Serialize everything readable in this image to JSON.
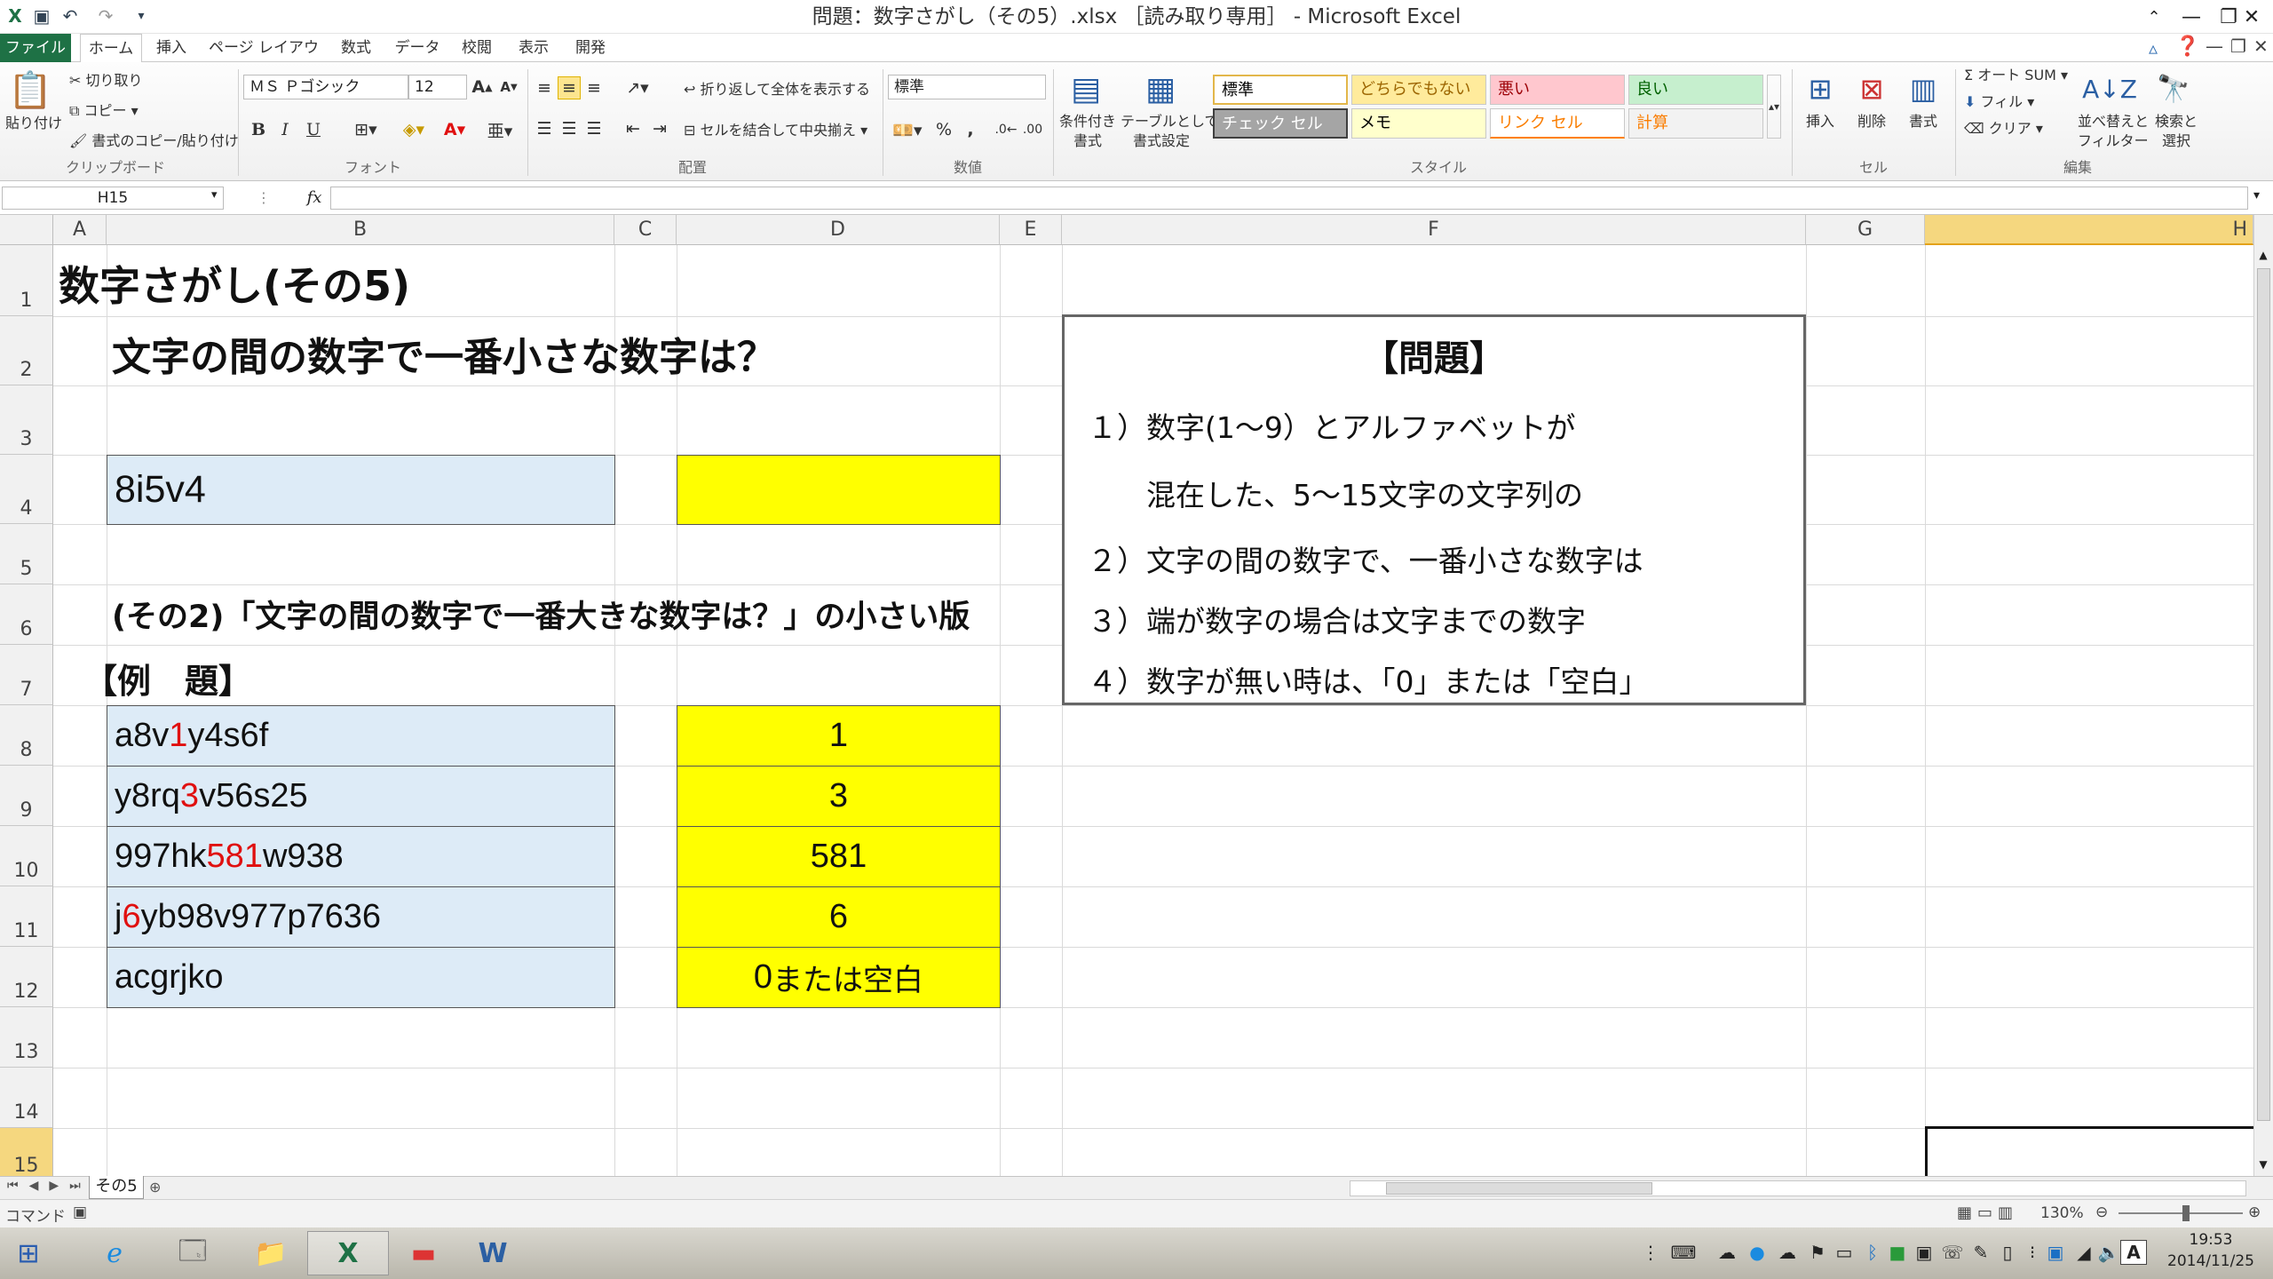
{
  "window": {
    "title": "問題：数字さがし（その5）.xlsx ［読み取り専用］ - Microsoft Excel",
    "min": "—",
    "max": "❐",
    "close": "✕"
  },
  "tabs": [
    {
      "label": "ファイル"
    },
    {
      "label": "ホーム"
    },
    {
      "label": "挿入"
    },
    {
      "label": "ページ レイアウト"
    },
    {
      "label": "数式"
    },
    {
      "label": "データ"
    },
    {
      "label": "校閲"
    },
    {
      "label": "表示"
    },
    {
      "label": "開発"
    }
  ],
  "ribbon": {
    "clipboard": {
      "paste": "貼り付け",
      "cut": "切り取り",
      "copy": "コピー",
      "format_painter": "書式のコピー/貼り付け",
      "label": "クリップボード"
    },
    "font": {
      "name": "ＭＳ Ｐゴシック",
      "size": "12",
      "label": "フォント",
      "bold": "B",
      "italic": "I",
      "underline": "U"
    },
    "alignment": {
      "wrap": "折り返して全体を表示する",
      "merge": "セルを結合して中央揃え",
      "label": "配置"
    },
    "number": {
      "format": "標準",
      "label": "数値",
      "percent": "%",
      "comma": ","
    },
    "styles": {
      "conditional": "条件付き",
      "conditional2": "書式",
      "table": "テーブルとして",
      "table2": "書式設定",
      "cells": [
        "標準",
        "どちらでもない",
        "悪い",
        "良い",
        "チェック セル",
        "メモ",
        "リンク セル",
        "計算"
      ],
      "label": "スタイル"
    },
    "cells": {
      "insert": "挿入",
      "delete": "削除",
      "format": "書式",
      "label": "セル"
    },
    "editing": {
      "autosum": "オート SUM",
      "fill": "フィル",
      "clear": "クリア",
      "sort": "並べ替えと",
      "sort2": "フィルター",
      "find": "検索と",
      "find2": "選択",
      "label": "編集"
    }
  },
  "formula_bar": {
    "name_box": "H15",
    "fx": "fx",
    "value": ""
  },
  "columns": [
    "A",
    "B",
    "C",
    "D",
    "E",
    "F",
    "G",
    "H"
  ],
  "rows": [
    "1",
    "2",
    "3",
    "4",
    "5",
    "6",
    "7",
    "8",
    "9",
    "10",
    "11",
    "12",
    "13",
    "14",
    "15"
  ],
  "sheet": {
    "title": "数字さがし(その5)",
    "question": "文字の間の数字で一番小さな数字は？",
    "input": "8i5v4",
    "note": "(その2)「文字の間の数字で一番大きな数字は？」の小さい版",
    "example_header": "【例　題】",
    "examples": [
      {
        "pre": "a8v",
        "hl": "1",
        "post": "y4s6f",
        "answer": "1"
      },
      {
        "pre": "y8rq",
        "hl": "3",
        "post": "v56s25",
        "answer": "3"
      },
      {
        "pre": "997hk",
        "hl": "581",
        "post": "w938",
        "answer": "581"
      },
      {
        "pre": "j",
        "hl": "6",
        "post": "yb98v977p7636",
        "answer": "6"
      },
      {
        "pre": "acgrjko",
        "hl": "",
        "post": "",
        "answer_num": "0",
        "answer_text": "または空白"
      }
    ]
  },
  "problem": {
    "heading": "【問題】",
    "lines": [
      "１）数字(1～9）とアルファベットが",
      "　　混在した、5～15文字の文字列の",
      "２）文字の間の数字で、一番小さな数字は",
      "３）端が数字の場合は文字までの数字",
      "４）数字が無い時は、「0」または「空白」"
    ]
  },
  "sheet_tab": "その5",
  "status": {
    "mode": "コマンド",
    "zoom": "130%"
  },
  "taskbar": {
    "time": "19:53",
    "date": "2014/11/25"
  },
  "colors": {
    "excel_green": "#1e7145",
    "cell_blue": "#ddebf7",
    "cell_yellow": "#ffff00",
    "highlight_red": "#e01010"
  }
}
